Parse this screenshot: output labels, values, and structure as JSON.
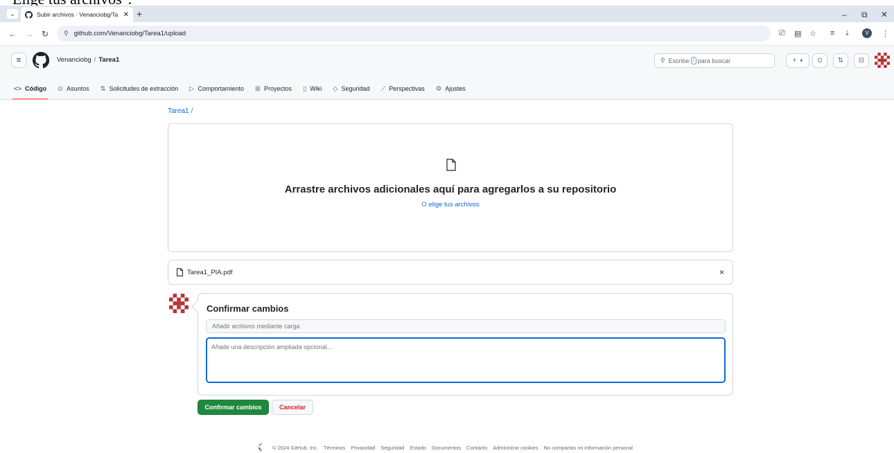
{
  "doc_heading": "Elige tus archivos\".",
  "browser": {
    "tab_title": "Subir archivos · Venanciobg/Ta",
    "url": "github.com/Venanciobg/Tarea1/upload",
    "profile_initial": "V"
  },
  "header": {
    "owner": "Venanciobg",
    "separator": "/",
    "repo": "Tarea1",
    "search_placeholder_pre": "Escribe",
    "search_key": "/",
    "search_placeholder_post": "para buscar"
  },
  "repo_nav": [
    {
      "icon": "code-icon",
      "glyph": "<>",
      "label": "Código"
    },
    {
      "icon": "issues-icon",
      "glyph": "⊙",
      "label": "Asuntos"
    },
    {
      "icon": "pull-request-icon",
      "glyph": "⇅",
      "label": "Solicitudes de extracción"
    },
    {
      "icon": "actions-icon",
      "glyph": "▷",
      "label": "Comportamiento"
    },
    {
      "icon": "projects-icon",
      "glyph": "⊞",
      "label": "Proyectos"
    },
    {
      "icon": "wiki-icon",
      "glyph": "▯",
      "label": "Wiki"
    },
    {
      "icon": "security-icon",
      "glyph": "◇",
      "label": "Seguridad"
    },
    {
      "icon": "insights-icon",
      "glyph": "⟋",
      "label": "Perspectivas"
    },
    {
      "icon": "settings-icon",
      "glyph": "⚙",
      "label": "Ajustes"
    }
  ],
  "path": {
    "repo": "Tarea1",
    "slash": "/"
  },
  "dropzone": {
    "title": "Arrastre archivos adicionales aquí para agregarlos a su repositorio",
    "sub_prefix": "O",
    "sub_link": "elige tus archivos"
  },
  "file": {
    "name": "Tarea1_PIA.pdf",
    "remove_glyph": "×"
  },
  "commit": {
    "title": "Confirmar cambios",
    "summary_placeholder": "Añadir archivos mediante carga",
    "description_placeholder": "Añade una descripción ampliada opcional..."
  },
  "actions": {
    "commit_label": "Confirmar cambios",
    "cancel_label": "Cancelar"
  },
  "footer": {
    "copyright": "© 2024 GitHub, Inc.",
    "links": [
      "Términos",
      "Privacidad",
      "Seguridad",
      "Estado",
      "Documentos",
      "Contacto",
      "Administrar cookies",
      "No compartas mi información personal"
    ]
  },
  "colors": {
    "accent_link": "#0969da",
    "primary_button": "#1f883d",
    "danger_text": "#cf222e",
    "active_tab_underline": "#fd8c73"
  }
}
